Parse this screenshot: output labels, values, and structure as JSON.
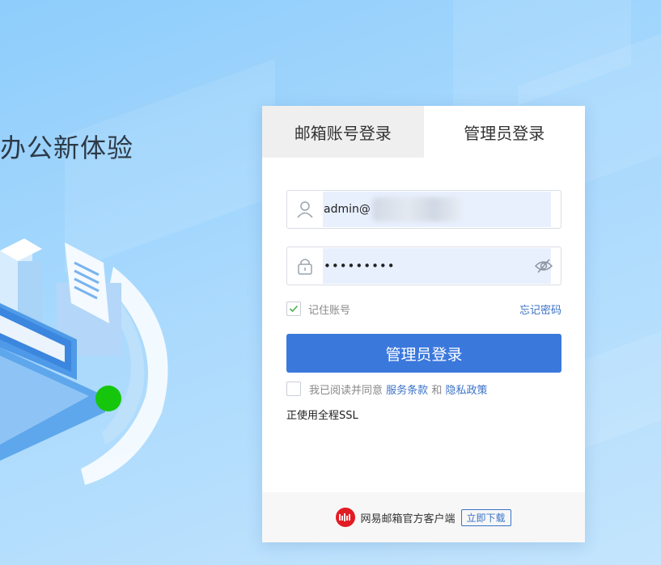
{
  "background": {
    "slogan": "办公新体验"
  },
  "login": {
    "tabs": [
      {
        "label": "邮箱账号登录",
        "active": false
      },
      {
        "label": "管理员登录",
        "active": true
      }
    ],
    "username": {
      "value": "admin@"
    },
    "password": {
      "value": "•••••••••"
    },
    "remember_label": "记住账号",
    "remember_checked": true,
    "forgot_label": "忘记密码",
    "submit_label": "管理员登录",
    "agree": {
      "prefix": "我已阅读并同意",
      "terms_label": "服务条款",
      "conj": "和",
      "privacy_label": "隐私政策",
      "checked": false
    },
    "ssl_text": "正使用全程SSL"
  },
  "footer": {
    "client_text": "网易邮箱官方客户端",
    "download_label": "立即下载"
  },
  "colors": {
    "accent": "#3b78dc",
    "link": "#3a72c8",
    "brand_red": "#e21b23"
  },
  "icons": [
    "user-icon",
    "lock-icon",
    "eye-off-icon",
    "checkmark-icon",
    "netease-mail-logo"
  ]
}
